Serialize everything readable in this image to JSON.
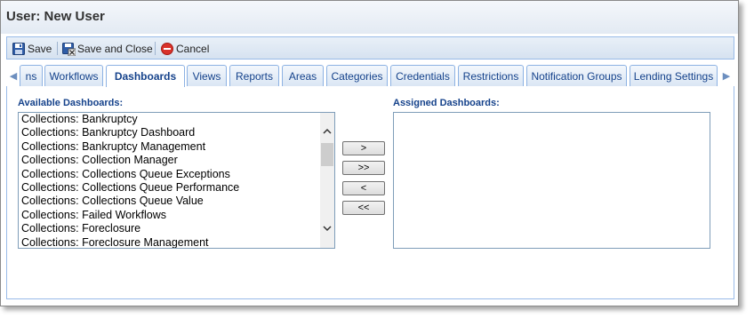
{
  "window": {
    "title": "User: New User"
  },
  "toolbar": {
    "save": "Save",
    "save_close": "Save and Close",
    "cancel": "Cancel"
  },
  "tabs": [
    {
      "label": "ns"
    },
    {
      "label": "Workflows"
    },
    {
      "label": "Dashboards",
      "active": true
    },
    {
      "label": "Views"
    },
    {
      "label": "Reports"
    },
    {
      "label": "Areas"
    },
    {
      "label": "Categories"
    },
    {
      "label": "Credentials"
    },
    {
      "label": "Restrictions"
    },
    {
      "label": "Notification Groups"
    },
    {
      "label": "Lending Settings"
    }
  ],
  "available": {
    "label": "Available Dashboards:",
    "items": [
      "Collections: Bankruptcy",
      "Collections: Bankruptcy Dashboard",
      "Collections: Bankruptcy Management",
      "Collections: Collection Manager",
      "Collections: Collections Queue Exceptions",
      "Collections: Collections Queue Performance",
      "Collections: Collections Queue Value",
      "Collections: Failed Workflows",
      "Collections: Foreclosure",
      "Collections: Foreclosure Management"
    ]
  },
  "assigned": {
    "label": "Assigned Dashboards:",
    "items": []
  },
  "move_buttons": {
    "add": ">",
    "add_all": ">>",
    "remove": "<",
    "remove_all": "<<"
  },
  "colors": {
    "accent": "#15428b",
    "border": "#99bbe8",
    "cancel_red": "#d9322b"
  }
}
